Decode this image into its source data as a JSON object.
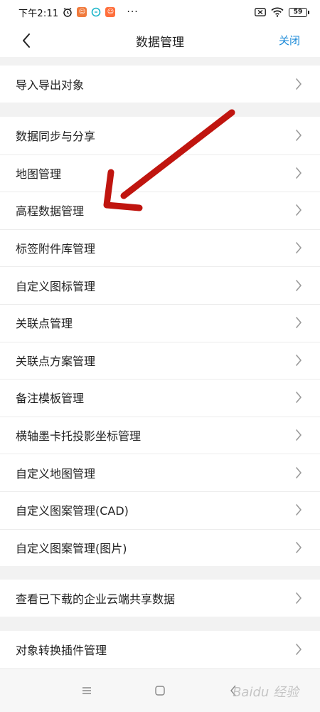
{
  "status_bar": {
    "time": "下午2:11",
    "battery": "59",
    "dots": "···"
  },
  "nav": {
    "title": "数据管理",
    "close_label": "关闭"
  },
  "groups": [
    {
      "items": [
        {
          "label": "导入导出对象"
        }
      ]
    },
    {
      "items": [
        {
          "label": "数据同步与分享"
        },
        {
          "label": "地图管理"
        },
        {
          "label": "高程数据管理"
        },
        {
          "label": "标签附件库管理"
        },
        {
          "label": "自定义图标管理"
        },
        {
          "label": "关联点管理"
        },
        {
          "label": "关联点方案管理"
        },
        {
          "label": "备注模板管理"
        },
        {
          "label": "横轴墨卡托投影坐标管理"
        },
        {
          "label": "自定义地图管理"
        },
        {
          "label": "自定义图案管理(CAD)"
        },
        {
          "label": "自定义图案管理(图片)"
        }
      ]
    },
    {
      "items": [
        {
          "label": "查看已下载的企业云端共享数据"
        }
      ]
    },
    {
      "items": [
        {
          "label": "对象转换插件管理"
        }
      ]
    }
  ],
  "watermark": "Baidu 经验",
  "colors": {
    "accent": "#1b8ad8",
    "arrow": "#c0150f",
    "background": "#f2f2f2"
  }
}
